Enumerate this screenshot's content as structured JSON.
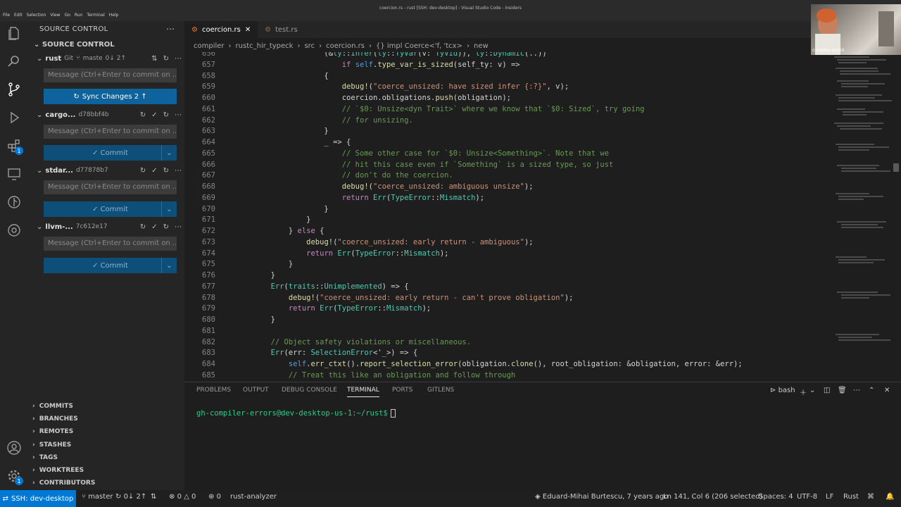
{
  "window": {
    "title": "coercion.rs - rust [SSH: dev-desktop] - Visual Studio Code - Insiders",
    "menu": [
      "File",
      "Edit",
      "Selection",
      "View",
      "Go",
      "Run",
      "Terminal",
      "Help"
    ]
  },
  "activity_badges": {
    "extensions": "1",
    "accounts": "1"
  },
  "sidebar": {
    "header": "SOURCE CONTROL",
    "section_title": "SOURCE CONTROL",
    "repos": [
      {
        "name": "rust",
        "provider": "Git",
        "branch": "maste",
        "sync": "0↓ 2↑"
      },
      {
        "name": "cargo...",
        "commit": "d78bbf4b"
      },
      {
        "name": "stdar...",
        "commit": "d77878b7"
      },
      {
        "name": "llvm-...",
        "commit": "7c612e17"
      }
    ],
    "message_placeholder": "Message (Ctrl+Enter to commit on ...",
    "sync_label": "Sync Changes 2 ↑",
    "commit_label": "✓ Commit",
    "sections": [
      "COMMITS",
      "BRANCHES",
      "REMOTES",
      "STASHES",
      "TAGS",
      "WORKTREES",
      "CONTRIBUTORS"
    ]
  },
  "tabs": [
    {
      "label": "coercion.rs",
      "active": true
    },
    {
      "label": "test.rs",
      "active": false
    }
  ],
  "breadcrumb": [
    "compiler",
    "rustc_hir_typeck",
    "src",
    "coercion.rs",
    "{} impl Coerce<'f, 'tcx>",
    "new"
  ],
  "code_lines": [
    {
      "n": "656",
      "t": "                    (&ty::Infer(ty::TyVar(v: TyVid)), ty::Dynamic(..))"
    },
    {
      "n": "657",
      "t": "                        if self.type_var_is_sized(self_ty: v) =>"
    },
    {
      "n": "658",
      "t": "                    {"
    },
    {
      "n": "659",
      "t": "                        debug!(\"coerce_unsized: have sized infer {:?}\", v);"
    },
    {
      "n": "660",
      "t": "                        coercion.obligations.push(obligation);"
    },
    {
      "n": "661",
      "t": "                        // `$0: Unsize<dyn Trait>` where we know that `$0: Sized`, try going"
    },
    {
      "n": "662",
      "t": "                        // for unsizing."
    },
    {
      "n": "663",
      "t": "                    }"
    },
    {
      "n": "664",
      "t": "                    _ => {"
    },
    {
      "n": "665",
      "t": "                        // Some other case for `$0: Unsize<Something>`. Note that we"
    },
    {
      "n": "666",
      "t": "                        // hit this case even if `Something` is a sized type, so just"
    },
    {
      "n": "667",
      "t": "                        // don't do the coercion."
    },
    {
      "n": "668",
      "t": "                        debug!(\"coerce_unsized: ambiguous unsize\");"
    },
    {
      "n": "669",
      "t": "                        return Err(TypeError::Mismatch);"
    },
    {
      "n": "670",
      "t": "                    }"
    },
    {
      "n": "671",
      "t": "                }"
    },
    {
      "n": "672",
      "t": "            } else {"
    },
    {
      "n": "673",
      "t": "                debug!(\"coerce_unsized: early return - ambiguous\");"
    },
    {
      "n": "674",
      "t": "                return Err(TypeError::Mismatch);"
    },
    {
      "n": "675",
      "t": "            }"
    },
    {
      "n": "676",
      "t": "        }"
    },
    {
      "n": "677",
      "t": "        Err(traits::Unimplemented) => {"
    },
    {
      "n": "678",
      "t": "            debug!(\"coerce_unsized: early return - can't prove obligation\");"
    },
    {
      "n": "679",
      "t": "            return Err(TypeError::Mismatch);"
    },
    {
      "n": "680",
      "t": "        }"
    },
    {
      "n": "681",
      "t": ""
    },
    {
      "n": "682",
      "t": "        // Object safety violations or miscellaneous."
    },
    {
      "n": "683",
      "t": "        Err(err: SelectionError<'_>) => {"
    },
    {
      "n": "684",
      "t": "            self.err_ctxt().report_selection_error(obligation.clone(), root_obligation: &obligation, error: &err);"
    },
    {
      "n": "685",
      "t": "            // Treat this like an obligation and follow through"
    }
  ],
  "panel": {
    "tabs": [
      "PROBLEMS",
      "OUTPUT",
      "DEBUG CONSOLE",
      "TERMINAL",
      "PORTS",
      "GITLENS"
    ],
    "active_tab": "TERMINAL",
    "shell": "bash",
    "prompt": "gh-compiler-errors@dev-desktop-us-1:~/rust$"
  },
  "webcam_label": "compiler-errors",
  "status": {
    "remote": "SSH: dev-desktop",
    "branch": "master",
    "sync": "0↓ 2↑",
    "errors": "0",
    "warnings": "0",
    "ports": "0",
    "analyzer": "rust-analyzer",
    "blame": "Eduard-Mihai Burtescu, 7 years ago",
    "position": "Ln 141, Col 6 (206 selected)",
    "spaces": "Spaces: 4",
    "encoding": "UTF-8",
    "eol": "LF",
    "language": "Rust"
  }
}
